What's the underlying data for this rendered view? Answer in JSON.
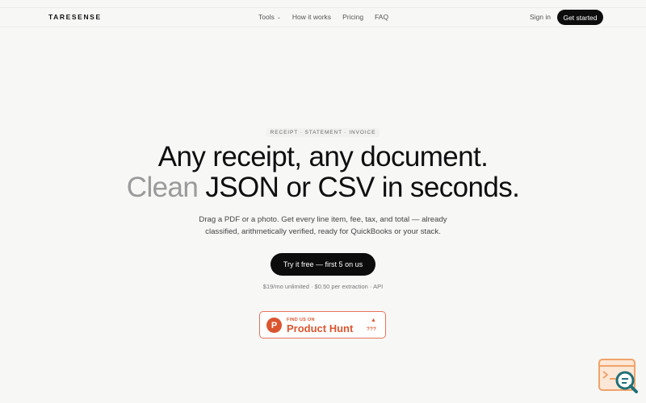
{
  "nav": {
    "logo": "TARESENSE",
    "links": [
      {
        "label": "Tools",
        "has_dropdown": true
      },
      {
        "label": "How it works"
      },
      {
        "label": "Pricing"
      },
      {
        "label": "FAQ"
      }
    ],
    "sign_in": "Sign in",
    "get_started": "Get started"
  },
  "hero": {
    "eyebrow": "RECEIPT · STATEMENT · INVOICE",
    "headline_line1": "Any receipt, any document.",
    "headline_line2_muted": "Clean",
    "headline_line2_rest": " JSON or CSV in seconds.",
    "sub_line1": "Drag a PDF or a photo. Get every line item, fee, tax, and total — already",
    "sub_line2": "classified, arithmetically verified, ready for QuickBooks or your stack.",
    "cta": "Try it free — first 5 on us",
    "pricing_note": "$19/mo unlimited · $0.50 per extraction · API"
  },
  "product_hunt": {
    "logo_letter": "P",
    "small_text": "FIND US ON",
    "big_text": "Product Hunt",
    "count": "???",
    "arrow": "▲"
  },
  "colors": {
    "background": "#f7f7f6",
    "primary_button": "#0d0d0d",
    "product_hunt": "#da552f",
    "widget_orange": "#f0a36a",
    "widget_teal": "#1f6f78"
  },
  "widget": {
    "icon": "chat-search-icon"
  }
}
